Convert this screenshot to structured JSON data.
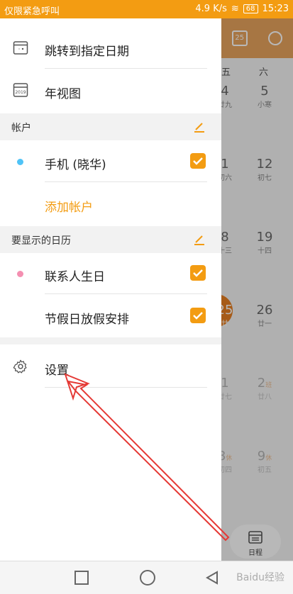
{
  "status": {
    "left_text": "仅限紧急呼叫",
    "speed": "4.9 K/s",
    "battery": "68",
    "time": "15:23"
  },
  "drawer": {
    "goto_date": "跳转到指定日期",
    "year_view": "年视图",
    "year_icon_text": "2019",
    "accounts_header": "帐户",
    "account_name": "手机 (晓华)",
    "add_account": "添加帐户",
    "calendars_header": "要显示的日历",
    "calendar_1": "联系人生日",
    "calendar_2": "节假日放假安排",
    "settings": "设置"
  },
  "background_calendar": {
    "calendar_icon_text": "25",
    "weekday_fri": "五",
    "weekday_sat": "六",
    "rows": [
      {
        "fri_num": "4",
        "fri_lunar": "廿九",
        "sat_num": "5",
        "sat_lunar": "小寒"
      },
      {
        "fri_num": "1",
        "fri_lunar": "初六",
        "sat_num": "12",
        "sat_lunar": "初七"
      },
      {
        "fri_num": "8",
        "fri_lunar": "十三",
        "sat_num": "19",
        "sat_lunar": "十四"
      },
      {
        "fri_num": "25",
        "fri_lunar": "廿",
        "sat_num": "26",
        "sat_lunar": "廿一"
      },
      {
        "fri_num": "1",
        "fri_lunar": "廿七",
        "sat_num": "2",
        "sat_lunar": "廿八",
        "sat_tag": "班"
      },
      {
        "fri_num": "8",
        "fri_lunar": "初四",
        "sat_num": "9",
        "sat_lunar": "初五",
        "fri_tag": "休",
        "sat_tag": "休"
      }
    ],
    "schedule_label": "日程"
  },
  "watermark": "Baidu经验",
  "colors": {
    "accent": "#f39c12",
    "account_dot": "#4fc3f7",
    "birthday_dot": "#f48fb1",
    "arrow": "#e53935"
  }
}
